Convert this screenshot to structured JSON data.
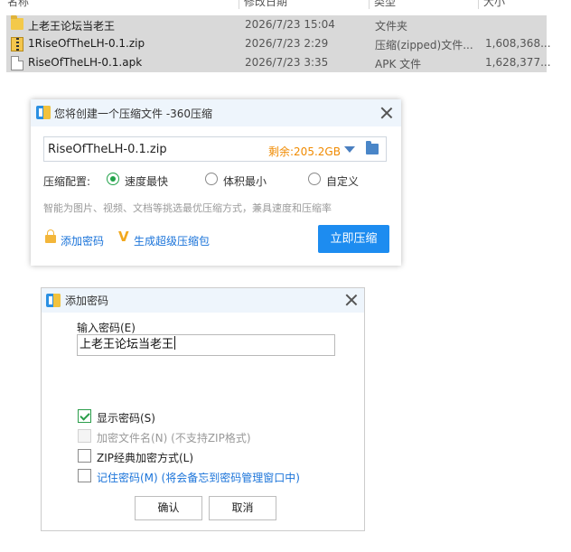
{
  "file_list": {
    "headers": [
      "名称",
      "修改日期",
      "类型",
      "大小"
    ],
    "rows": [
      {
        "icon": "folder-icon",
        "name": "上老王论坛当老王",
        "date": "2026/7/23 15:04",
        "type": "文件夹",
        "size": ""
      },
      {
        "icon": "zip-icon",
        "name": "1RiseOfTheLH-0.1.zip",
        "date": "2026/7/23 2:29",
        "type": "压缩(zipped)文件...",
        "size": "1,608,368..."
      },
      {
        "icon": "file-icon",
        "name": "RiseOfTheLH-0.1.apk",
        "date": "2026/7/23 3:35",
        "type": "APK 文件",
        "size": "1,628,377..."
      }
    ]
  },
  "compress_dialog": {
    "title": "您将创建一个压缩文件 -360压缩",
    "path_value": "RiseOfTheLH-0.1.zip",
    "free_space": "剩余:205.2GB",
    "config_label": "压缩配置:",
    "options": [
      "速度最快",
      "体积最小",
      "自定义"
    ],
    "selected_option": "速度最快",
    "hint": "智能为图片、视频、文档等挑选最优压缩方式，兼具速度和压缩率",
    "add_password_link": "添加密码",
    "sfx_link": "生成超级压缩包",
    "compress_button": "立即压缩",
    "accent_color": "#1d8cf0",
    "free_space_color": "#f08a00"
  },
  "password_dialog": {
    "title": "添加密码",
    "input_label": "输入密码(E)",
    "password_value": "上老王论坛当老王",
    "checkboxes": [
      {
        "label": "显示密码(S)",
        "checked": true,
        "disabled": false
      },
      {
        "label": "加密文件名(N)  (不支持ZIP格式)",
        "checked": false,
        "disabled": true
      },
      {
        "label": "ZIP经典加密方式(L)",
        "checked": false,
        "disabled": false
      },
      {
        "label": "记住密码(M) (将会备忘到密码管理窗口中)",
        "checked": false,
        "disabled": false
      }
    ],
    "ok_button": "确认",
    "cancel_button": "取消"
  }
}
